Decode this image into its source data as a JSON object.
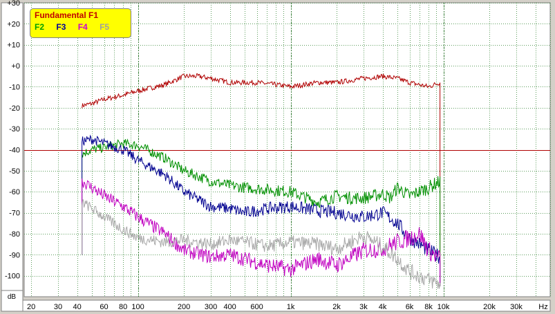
{
  "legend": {
    "title": "Fundamental F1",
    "items": [
      {
        "label": "F2",
        "color": "#00a000"
      },
      {
        "label": "F3",
        "color": "#000099"
      },
      {
        "label": "F4",
        "color": "#cc00cc"
      },
      {
        "label": "F5",
        "color": "#a0a0a0"
      }
    ]
  },
  "chart_data": {
    "type": "line",
    "xscale": "log",
    "xlim": [
      18,
      50000
    ],
    "ylim": [
      -110,
      30
    ],
    "yunit": "dB",
    "xunit": "Hz",
    "yticks": [
      "+30",
      "+20",
      "+10",
      "+0",
      "-10",
      "-20",
      "-30",
      "-40",
      "-50",
      "-60",
      "-70",
      "-80",
      "-90",
      "-100"
    ],
    "yticks_values": [
      30,
      20,
      10,
      0,
      -10,
      -20,
      -30,
      -40,
      -50,
      -60,
      -70,
      -80,
      -90,
      -100
    ],
    "xticks": [
      {
        "v": 20,
        "label": "20"
      },
      {
        "v": 30,
        "label": "30"
      },
      {
        "v": 40,
        "label": "40"
      },
      {
        "v": 60,
        "label": "60"
      },
      {
        "v": 80,
        "label": "80"
      },
      {
        "v": 100,
        "label": "100"
      },
      {
        "v": 200,
        "label": "200"
      },
      {
        "v": 300,
        "label": "300"
      },
      {
        "v": 400,
        "label": "400"
      },
      {
        "v": 600,
        "label": "600"
      },
      {
        "v": 1000,
        "label": "1k"
      },
      {
        "v": 2000,
        "label": "2k"
      },
      {
        "v": 3000,
        "label": "3k"
      },
      {
        "v": 4000,
        "label": "4k"
      },
      {
        "v": 6000,
        "label": "6k"
      },
      {
        "v": 8000,
        "label": "8k"
      },
      {
        "v": 10000,
        "label": "10k"
      },
      {
        "v": 20000,
        "label": "20k"
      },
      {
        "v": 30000,
        "label": "30k"
      },
      {
        "v": 50000,
        "label": "Hz"
      }
    ],
    "reference_level": -40,
    "grid": true,
    "series": [
      {
        "name": "Fundamental F1",
        "color": "#b00000",
        "x": [
          43,
          50,
          60,
          80,
          100,
          150,
          200,
          250,
          300,
          400,
          500,
          600,
          800,
          1000,
          1500,
          2000,
          3000,
          4000,
          5000,
          6000,
          8000,
          9500
        ],
        "y": [
          -19,
          -18,
          -16,
          -14,
          -12,
          -9,
          -5,
          -5,
          -6,
          -8,
          -8,
          -8,
          -9,
          -10,
          -8,
          -8,
          -6,
          -5,
          -6,
          -8,
          -10,
          -8
        ]
      },
      {
        "name": "F2",
        "color": "#009000",
        "x": [
          43,
          50,
          60,
          80,
          100,
          150,
          200,
          300,
          400,
          500,
          700,
          1000,
          1500,
          2000,
          2500,
          3000,
          3500,
          4000,
          4500,
          5000,
          6000,
          8000,
          9500
        ],
        "y": [
          -42,
          -40,
          -39,
          -37,
          -38,
          -44,
          -50,
          -55,
          -57,
          -58,
          -59,
          -60,
          -65,
          -62,
          -63,
          -63,
          -62,
          -61,
          -63,
          -58,
          -62,
          -58,
          -55
        ]
      },
      {
        "name": "F3",
        "color": "#000090",
        "x": [
          43,
          50,
          60,
          80,
          100,
          150,
          200,
          300,
          400,
          500,
          700,
          1000,
          1500,
          2000,
          3000,
          4000,
          5000,
          6000,
          7000,
          8000,
          9500
        ],
        "y": [
          -36,
          -35,
          -37,
          -40,
          -45,
          -52,
          -60,
          -67,
          -68,
          -70,
          -68,
          -67,
          -69,
          -70,
          -72,
          -70,
          -75,
          -82,
          -85,
          -88,
          -91
        ]
      },
      {
        "name": "F4",
        "color": "#c000c0",
        "x": [
          43,
          50,
          60,
          80,
          100,
          150,
          200,
          300,
          400,
          500,
          700,
          1000,
          1500,
          2000,
          3000,
          4000,
          5000,
          6000,
          7000,
          8000,
          9500
        ],
        "y": [
          -55,
          -58,
          -62,
          -67,
          -72,
          -80,
          -88,
          -91,
          -90,
          -92,
          -95,
          -97,
          -92,
          -95,
          -88,
          -87,
          -84,
          -82,
          -80,
          -88,
          -92
        ]
      },
      {
        "name": "F5",
        "color": "#a8a8a8",
        "x": [
          43,
          50,
          60,
          80,
          100,
          150,
          200,
          300,
          400,
          500,
          700,
          1000,
          1500,
          2000,
          3000,
          4000,
          5000,
          6000,
          8000,
          9500
        ],
        "y": [
          -65,
          -68,
          -72,
          -78,
          -82,
          -84,
          -83,
          -85,
          -83,
          -84,
          -86,
          -84,
          -85,
          -87,
          -81,
          -86,
          -92,
          -98,
          -102,
          -104
        ]
      }
    ]
  }
}
